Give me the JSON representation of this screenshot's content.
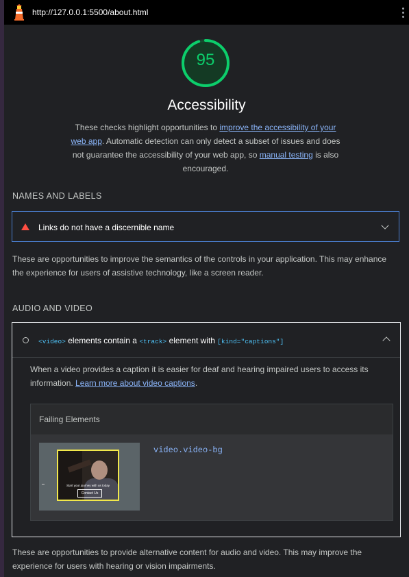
{
  "browser": {
    "url": "http://127.0.0.1:5500/about.html",
    "menu_icon": "kebab-menu-icon",
    "logo_icon": "lighthouse-icon"
  },
  "score": {
    "value": "95",
    "color": "#0cce6b",
    "fraction": 0.95
  },
  "category": {
    "title": "Accessibility",
    "desc_1": "These checks highlight opportunities to ",
    "desc_link_1": "improve the accessibility of your web app",
    "desc_2": ". Automatic detection can only detect a subset of issues and does not guarantee the accessibility of your web app, so ",
    "desc_link_2": "manual testing",
    "desc_3": " is also encouraged."
  },
  "sections": {
    "names": {
      "title": "NAMES AND LABELS",
      "audit_title": "Links do not have a discernible name",
      "audit_status_color": "#ff4e42",
      "description": "These are opportunities to improve the semantics of the controls in your application. This may enhance the experience for users of assistive technology, like a screen reader."
    },
    "av": {
      "title": "AUDIO AND VIDEO",
      "audit": {
        "code_1": "<video>",
        "text_1": " elements contain a ",
        "code_2": "<track>",
        "text_2": " element with ",
        "code_3": "[kind=\"captions\"]",
        "body": "When a video provides a caption it is easier for deaf and hearing impaired users to access its information. ",
        "body_link": "Learn more about video captions",
        "body_end": ".",
        "failing_header": "Failing Elements",
        "thumb_caption": "Start your journey with us today",
        "thumb_button": "Contact Us",
        "selector": "video.video-bg"
      },
      "description": "These are opportunities to provide alternative content for audio and video. This may improve the experience for users with hearing or vision impairments."
    }
  }
}
